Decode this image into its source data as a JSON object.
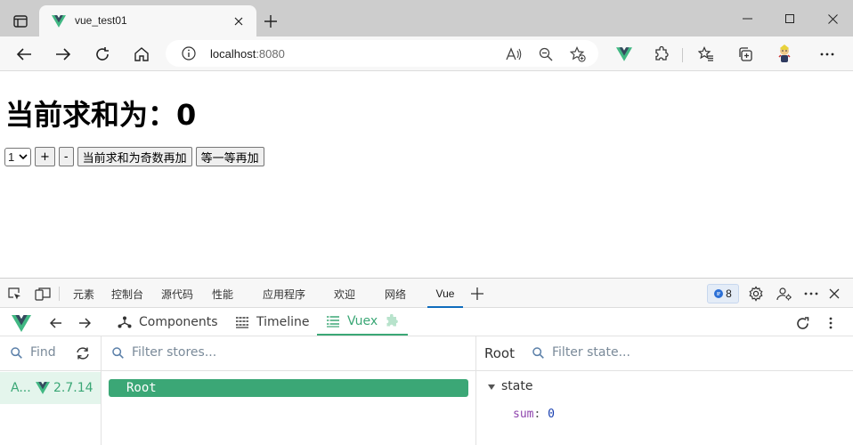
{
  "browser": {
    "tab": {
      "title": "vue_test01"
    },
    "address": {
      "host": "localhost",
      "port": ":8080"
    },
    "colors": {
      "vue_green": "#3ba776",
      "vue_dark": "#35495e",
      "accent_blue": "#0f6cbd"
    }
  },
  "page": {
    "heading": "当前求和为：0",
    "select": {
      "value": "1",
      "options": [
        "1"
      ]
    },
    "buttons": {
      "increment": "+",
      "decrement": "-",
      "increment_odd": "当前求和为奇数再加",
      "increment_wait": "等一等再加"
    }
  },
  "devtools": {
    "tabs": [
      "元素",
      "控制台",
      "源代码",
      "性能",
      "应用程序",
      "欢迎",
      "网络",
      "Vue"
    ],
    "active_tab": "Vue",
    "issues_count": "8",
    "vue": {
      "tabs": {
        "components": "Components",
        "timeline": "Timeline",
        "vuex": "Vuex"
      },
      "active_tab": "Vuex",
      "apps": {
        "find_placeholder": "Find",
        "selected_app": "A...",
        "version": "2.7.14"
      },
      "stores": {
        "filter_placeholder": "Filter stores...",
        "items": [
          "Root"
        ]
      },
      "state": {
        "title": "Root",
        "filter_placeholder": "Filter state...",
        "section": "state",
        "entries": [
          {
            "key": "sum",
            "separator": ":",
            "value": "0"
          }
        ]
      }
    }
  }
}
